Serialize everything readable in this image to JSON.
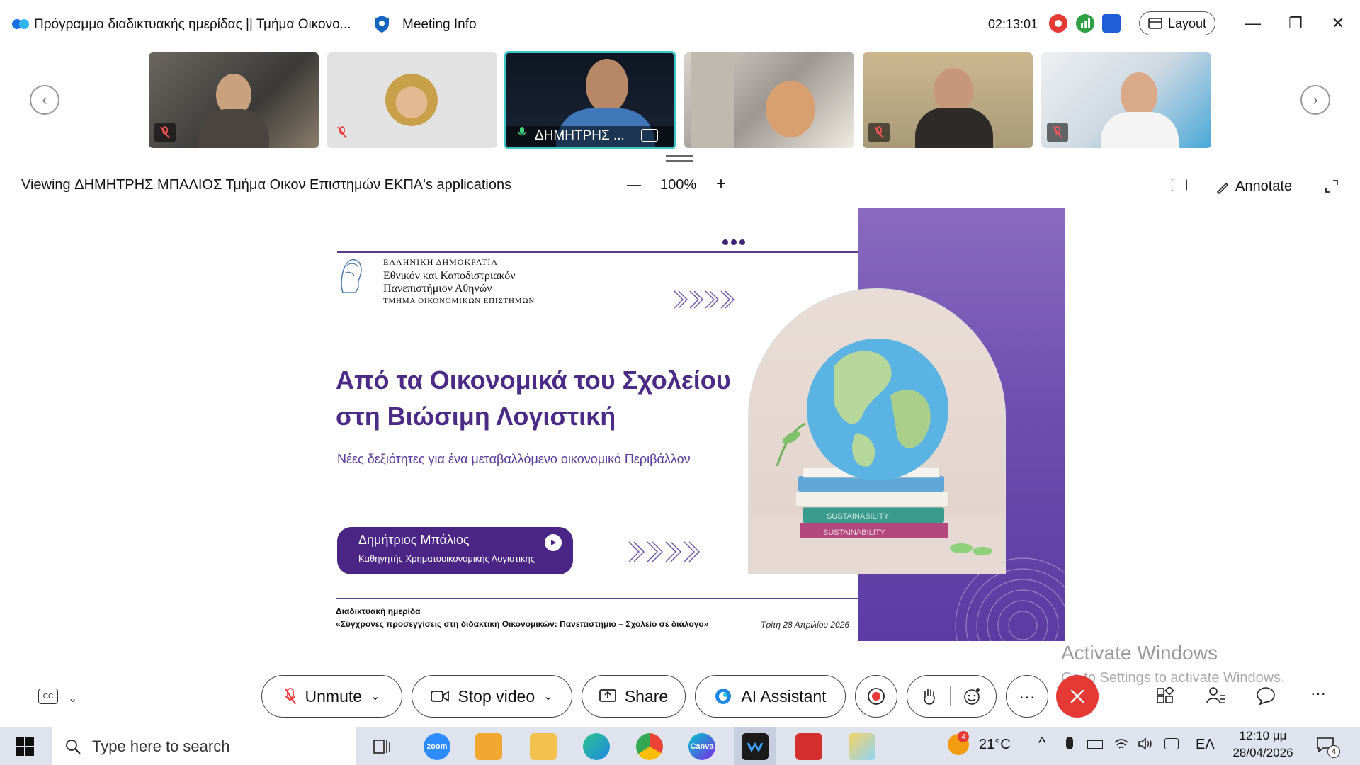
{
  "window": {
    "title": "Πρόγραμμα διαδικτυακής ημερίδας || Τμήμα Οικονο...",
    "meeting_info": "Meeting Info",
    "timer": "02:13:01",
    "layout_label": "Layout",
    "minimize": "—",
    "restore": "❐",
    "close": "✕"
  },
  "participants": [
    {
      "name": "",
      "muted": true
    },
    {
      "name": "",
      "muted": true
    },
    {
      "name": "ΔΗΜΗΤΡΗΣ ...",
      "muted": false,
      "active": true
    },
    {
      "name": "",
      "muted": false
    },
    {
      "name": "",
      "muted": true
    },
    {
      "name": "",
      "muted": true
    }
  ],
  "share_bar": {
    "viewing_text": "Viewing ΔΗΜΗΤΡΗΣ ΜΠΑΛΙΟΣ Τμήμα Οικον Επιστημών ΕΚΠΑ's applications",
    "zoom_minus": "—",
    "zoom_level": "100%",
    "zoom_plus": "+",
    "annotate": "Annotate"
  },
  "slide": {
    "header_line1": "ΕΛΛΗΝΙΚΗ ΔΗΜΟΚΡΑΤΙΑ",
    "header_line2": "Εθνικόν και Καποδιστριακόν",
    "header_line3": "Πανεπιστήμιον Αθηνών",
    "header_line4": "ΤΜΗΜΑ ΟΙΚΟΝΟΜΙΚΩΝ ΕΠΙΣΤΗΜΩΝ",
    "title_line1": "Από τα Οικονομικά του Σχολείου",
    "title_line2": "στη Βιώσιμη Λογιστική",
    "subtitle": "Νέες δεξιότητες για ένα μεταβαλλόμενο οικονομικό Περιβάλλον",
    "speaker_name": "Δημήτριος Μπάλιος",
    "speaker_role": "Καθηγητής Χρηματοοικονομικής Λογιστικής",
    "footer_line1": "Διαδικτυακή ημερίδα",
    "footer_line2": "«Σύγχρονες προσεγγίσεις στη διδακτική Οικονομικών: Πανεπιστήμιο – Σχολείο σε διάλογο»",
    "footer_date": "Τρίτη 28 Απριλίου 2026",
    "book_label": "SUSTAINABILITY"
  },
  "watermark": {
    "line1": "Activate Windows",
    "line2": "Go to Settings to activate Windows."
  },
  "controls": {
    "unmute": "Unmute",
    "stop_video": "Stop video",
    "share": "Share",
    "ai_assistant": "AI Assistant",
    "more": "···"
  },
  "taskbar": {
    "search_placeholder": "Type here to search",
    "zoom_label": "zoom",
    "canva_label": "Canva",
    "weather_badge": "4",
    "temperature": "21°C",
    "language": "ΕΛ",
    "time": "12:10 μμ",
    "date": "28/04/2026",
    "notif_count": "4"
  },
  "colors": {
    "accent_purple": "#4b2586",
    "leave_red": "#e53935",
    "active_tile_border": "#3cc6c6"
  }
}
